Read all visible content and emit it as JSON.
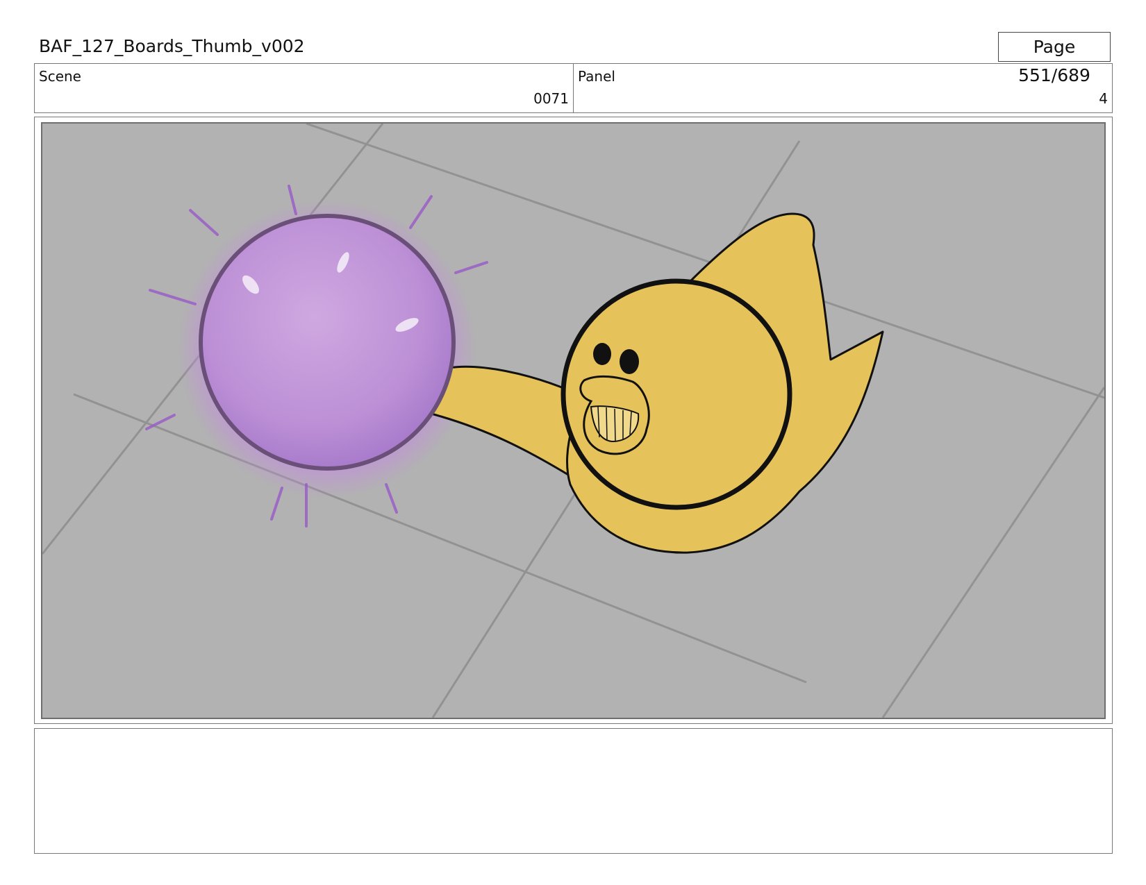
{
  "header": {
    "title": "BAF_127_Boards_Thumb_v002",
    "page": "Page 551/689"
  },
  "info": {
    "scene_label": "Scene",
    "scene_value": "0071",
    "panel_label": "Panel",
    "panel_value": "4"
  },
  "artwork": {
    "floor_color": "#b2b2b2",
    "orb_color": "#c49ad9",
    "character_color": "#e6c25a",
    "outline_color": "#111111"
  },
  "notes": {
    "text": ""
  }
}
